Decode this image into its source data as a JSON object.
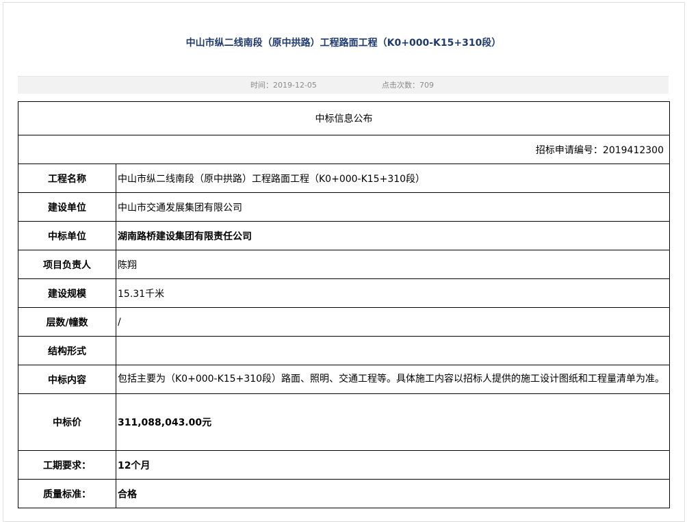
{
  "article": {
    "title": "中山市纵二线南段（原中拱路）工程路面工程（K0+000-K15+310段）",
    "time_text": "时间：2019-12-05",
    "clicks_text": "点击次数：709"
  },
  "notice": {
    "heading": "中标信息公布",
    "application_no": "招标申请编号：2019412300",
    "rows": [
      {
        "label": "工程名称",
        "value": "中山市纵二线南段（原中拱路）工程路面工程（K0+000-K15+310段）"
      },
      {
        "label": "建设单位",
        "value": "中山市交通发展集团有限公司"
      },
      {
        "label": "中标单位",
        "value": "湖南路桥建设集团有限责任公司"
      },
      {
        "label": "项目负责人",
        "value": "陈翔"
      },
      {
        "label": "建设规模",
        "value": "15.31千米"
      },
      {
        "label": "层数/幢数",
        "value": "/"
      },
      {
        "label": "结构形式",
        "value": ""
      },
      {
        "label": "中标内容",
        "value": "包括主要为（K0+000-K15+310段）路面、照明、交通工程等。具体施工内容以招标人提供的施工设计图纸和工程量清单为准。"
      },
      {
        "label": "中标价",
        "value": "311,088,043.00元"
      },
      {
        "label": "工期要求：",
        "value": "12个月"
      },
      {
        "label": "质量标准：",
        "value": "合格"
      }
    ]
  },
  "colors": {
    "title": "#1f3a6e",
    "highlight": "#1a0dab",
    "border": "#000000"
  }
}
